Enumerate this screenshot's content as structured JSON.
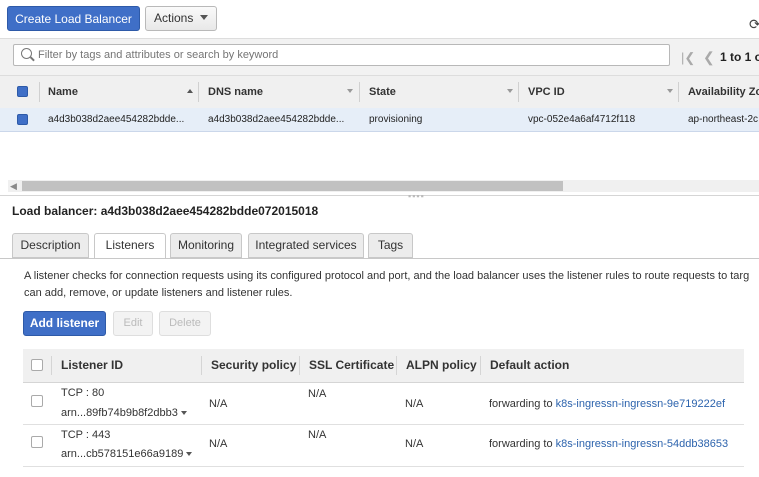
{
  "toolbar": {
    "create_label": "Create Load Balancer",
    "actions_label": "Actions"
  },
  "filter": {
    "placeholder": "Filter by tags and attributes or search by keyword",
    "pager_text": "1 to 1 o"
  },
  "lb_table": {
    "columns": [
      "Name",
      "DNS name",
      "State",
      "VPC ID",
      "Availability Zo"
    ],
    "row": {
      "name": "a4d3b038d2aee454282bdde...",
      "dns": "a4d3b038d2aee454282bdde...",
      "state": "provisioning",
      "vpc": "vpc-052e4a6af4712f118",
      "az": "ap-northeast-2c"
    }
  },
  "details": {
    "title": "Load balancer: a4d3b038d2aee454282bdde072015018",
    "tabs": [
      "Description",
      "Listeners",
      "Monitoring",
      "Integrated services",
      "Tags"
    ],
    "active_tab": "Listeners",
    "description_line1": "A listener checks for connection requests using its configured protocol and port, and the load balancer uses the listener rules to route requests to targ",
    "description_line2": "can add, remove, or update listeners and listener rules.",
    "add_label": "Add listener",
    "edit_label": "Edit",
    "delete_label": "Delete"
  },
  "listeners": {
    "columns": [
      "Listener ID",
      "Security policy",
      "SSL Certificate",
      "ALPN policy",
      "Default action"
    ],
    "rows": [
      {
        "protocol": "TCP : 80",
        "arn": "arn...89fb74b9b8f2dbb3",
        "security": "N/A",
        "ssl": "N/A",
        "alpn": "N/A",
        "action_prefix": "forwarding to",
        "target": "k8s-ingressn-ingressn-9e719222ef"
      },
      {
        "protocol": "TCP : 443",
        "arn": "arn...cb578151e66a9189",
        "security": "N/A",
        "ssl": "N/A",
        "alpn": "N/A",
        "action_prefix": "forwarding to",
        "target": "k8s-ingressn-ingressn-54ddb38653"
      }
    ]
  },
  "icons": {
    "search": "search-icon",
    "refresh": "refresh-icon",
    "first": "first-page-icon",
    "prev": "prev-page-icon"
  },
  "colors": {
    "primary": "#3f6fc7",
    "selected_row": "#e6eef8",
    "link": "#2c63ad"
  }
}
